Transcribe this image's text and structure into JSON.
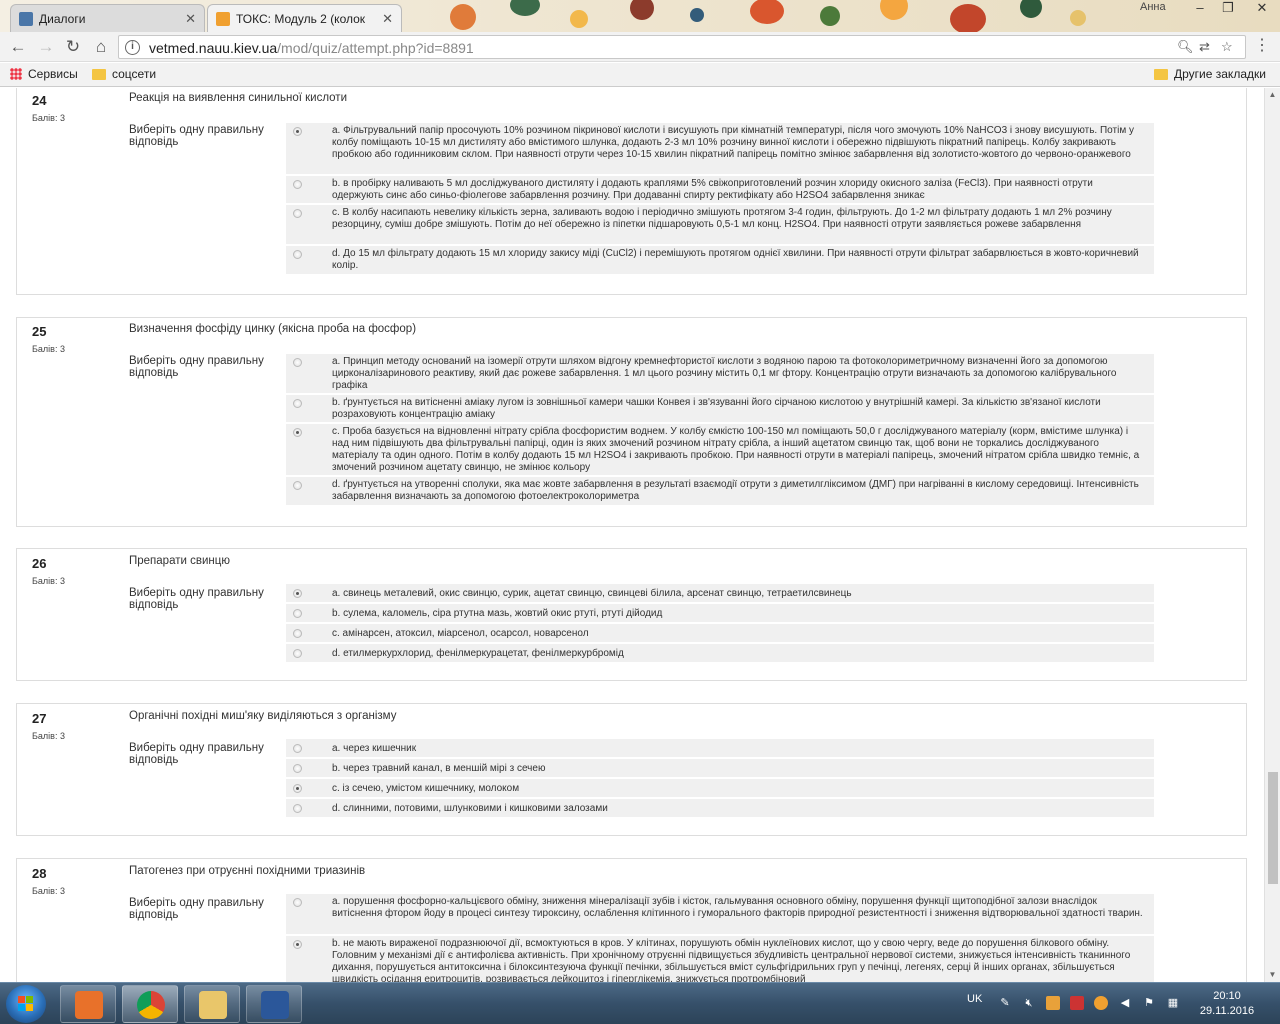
{
  "browser": {
    "tabs": [
      {
        "title": "Диалоги",
        "active": false,
        "favicon_color": "#4a76a8"
      },
      {
        "title": "ТОКС: Модуль 2 (колок",
        "active": true,
        "favicon_color": "#f0a030"
      }
    ],
    "user": "Анна",
    "url_host": "vetmed.nauu.kiev.ua",
    "url_path": "/mod/quiz/attempt.php?id=8891",
    "bookmarks": [
      {
        "label": "Сервисы",
        "icon": "apps-icon"
      },
      {
        "label": "соцсети",
        "icon": "folder-icon"
      }
    ],
    "other_bookmarks": "Другие закладки"
  },
  "prompt_label": "Виберіть одну правильну відповідь",
  "questions": [
    {
      "number": "24",
      "grade": "Балів: 3",
      "text": "Реакція на виявлення синильної кислоти",
      "answers": [
        {
          "text": "a. Фільтрувальний папір просочують 10% розчином пікринової кислоти і висушують при кімнатній температурі, після чого змочують 10% NaHCO3 і знову висушують. Потім у колбу поміщають 10-15 мл дистиляту або вмістимого шлунка, додають 2-3 мл 10% розчину винної кислоти і обережно підвішують пікратний папірець. Колбу закривають пробкою або годинниковим склом. При наявності отрути через 10-15 хвилин пікратний папірець помітно змінює забарвлення від золотисто-жовтого до червоно-оранжевого",
          "checked": true
        },
        {
          "text": "b. в пробірку наливають 5 мл досліджуваного дистиляту і додають краплями 5% свіжоприготовлений розчин хлориду окисного заліза (FeCl3). При наявності отрути одержують синє або синьо-фіолегове забарвлення розчину. При додаванні спирту ректифікату або H2SO4 забарвлення зникає",
          "checked": false
        },
        {
          "text": "c. В колбу насипають невелику кількість зерна, заливають водою і періодично змішують протягом 3-4 годин, фільтрують. До 1-2 мл фільтрату додають 1 мл 2% розчину резорцину, суміш добре змішують. Потім до неї обережно із піпетки підшаровують 0,5-1 мл конц. H2SO4. При наявності отрути заявляється рожеве забарвлення",
          "checked": false
        },
        {
          "text": "d. До 15 мл фільтрату додають 15 мл хлориду закису міді (CuCl2) і перемішують протягом однієї хвилини. При наявності отрути фільтрат забарвлюється в жовто-коричневий колір.",
          "checked": false
        }
      ]
    },
    {
      "number": "25",
      "grade": "Балів: 3",
      "text": "Визначення фосфіду цинку (якісна проба на фосфор)",
      "answers": [
        {
          "text": "a. Принцип методу оснований на ізомерії отрути шляхом відгону кремнефтористої кислоти з водяною парою та фотоколориметричному визначенні його за допомогою цирконалізаринового реактиву, який дає рожеве забарвлення. 1 мл цього розчину містить 0,1 мг фтору. Концентрацію отрути визначають за допомогою калібрувального графіка",
          "checked": false
        },
        {
          "text": "b. ґрунтується на витісненні аміаку лугом із зовнішньої камери чашки Конвея і зв'язуванні його сірчаною кислотою у внутрішній камері. За кількістю зв'язаної кислоти розраховують концентрацію аміаку",
          "checked": false
        },
        {
          "text": "c. Проба базується на відновленні нітрату срібла фосфористим воднем. У колбу ємкістю 100-150 мл поміщають 50,0 г досліджуваного матеріалу (корм, вмістиме шлунка) і над ним підвішують два фільтрувальні папірці, один із яких змочений розчином нітрату срібла, а інший ацетатом свинцю так, щоб вони не торкались досліджуваного матеріалу та один одного. Потім в колбу додають 15 мл H2SO4 і закривають пробкою. При наявності отрути в матеріалі папірець, змочений нітратом срібла швидко темніє, а змочений розчином ацетату свинцю, не змінює кольору",
          "checked": true
        },
        {
          "text": "d. ґрунтується на утворенні сполуки, яка має жовте забарвлення в результаті взаємодії отрути з диметилгліксимом (ДМГ) при нагріванні в кислому середовищі. Інтенсивність забарвлення визначають за допомогою фотоелектроколориметра",
          "checked": false
        }
      ]
    },
    {
      "number": "26",
      "grade": "Балів: 3",
      "text": "Препарати свинцю",
      "answers": [
        {
          "text": "a. свинець металевий, окис свинцю, сурик, ацетат свинцю, свинцеві білила, арсенат свинцю, тетраетилсвинець",
          "checked": true
        },
        {
          "text": "b. сулема, каломель, сіра ртутна мазь, жовтий окис ртуті, ртуті дійодид",
          "checked": false
        },
        {
          "text": "c. амінарсен, атоксил, міарсенол, осарсол, новарсенол",
          "checked": false
        },
        {
          "text": "d. етилмеркурхлорид, фенілмеркурацетат, фенілмеркурбромід",
          "checked": false
        }
      ]
    },
    {
      "number": "27",
      "grade": "Балів: 3",
      "text": "Органічні похідні миш'яку виділяються з організму",
      "answers": [
        {
          "text": "a. через кишечник",
          "checked": false
        },
        {
          "text": "b. через травний канал, в меншій мірі з сечею",
          "checked": false
        },
        {
          "text": "c. із сечею, умістом кишечнику, молоком",
          "checked": true
        },
        {
          "text": "d. слинними, потовими, шлунковими і кишковими залозами",
          "checked": false
        }
      ]
    },
    {
      "number": "28",
      "grade": "Балів: 3",
      "text": "Патогенез при отруєнні похідними триазинів",
      "answers": [
        {
          "text": "a. порушення фосфорно-кальцієвого обміну, зниження мінералізації зубів і кісток, гальмування основного обміну, порушення функції щитоподібної залози внаслідок витіснення фтором йоду в процесі синтезу тироксину, ослаблення клітинного і гуморального факторів природної резистентності і зниження відтворювальної здатності тварин.",
          "checked": false
        },
        {
          "text": "b. не мають вираженої подразнюючої дії, всмоктуються в кров. У клітинах, порушують обмін нуклеїнових кислот, що у свою чергу, веде до порушення білкового обміну. Головним у механізмі дії є антифолієва активність. При хронічному отруєнні підвищується збудливість центральної нервової системи, знижується інтенсивність тканинного дихання, порушується антитоксична і білоксинтезуюча функції печінки, збільшується вміст сульфгідрильних груп у печінці, легенях, серці й інших органах, збільшується швидкість осідання еритроцитів, розвивається лейкоцитоз і гіперглікемія, знижується протромбіновий",
          "checked": true
        }
      ]
    }
  ],
  "taskbar": {
    "language": "UK",
    "time": "20:10",
    "date": "29.11.2016"
  }
}
